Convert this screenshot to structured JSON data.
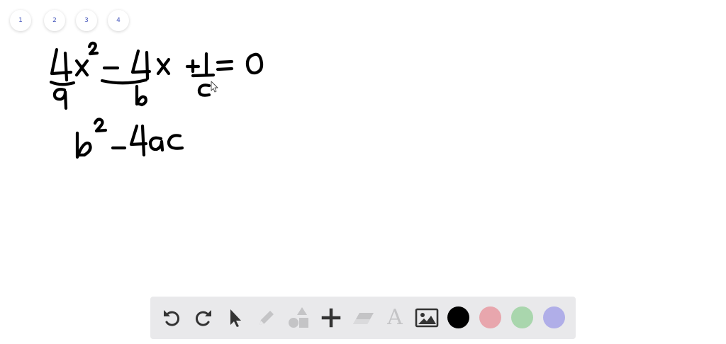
{
  "pages": {
    "tabs": [
      {
        "label": "1"
      },
      {
        "label": "2"
      },
      {
        "label": "3"
      },
      {
        "label": "4"
      }
    ]
  },
  "toolbar": {
    "tools": [
      {
        "name": "undo",
        "icon": "undo-icon",
        "enabled": true
      },
      {
        "name": "redo",
        "icon": "redo-icon",
        "enabled": true
      },
      {
        "name": "select",
        "icon": "cursor-arrow-icon",
        "enabled": true
      },
      {
        "name": "pen",
        "icon": "pencil-icon",
        "enabled": false
      },
      {
        "name": "shapes",
        "icon": "shapes-icon",
        "enabled": false
      },
      {
        "name": "add",
        "icon": "plus-icon",
        "enabled": true
      },
      {
        "name": "eraser",
        "icon": "eraser-icon",
        "enabled": false
      },
      {
        "name": "text",
        "icon": "text-icon",
        "label": "A",
        "enabled": false
      },
      {
        "name": "image",
        "icon": "image-icon",
        "enabled": true
      }
    ],
    "colors": [
      {
        "name": "black",
        "hex": "#000000"
      },
      {
        "name": "pink",
        "hex": "#e8a6ad"
      },
      {
        "name": "green",
        "hex": "#a9d6ad"
      },
      {
        "name": "purple",
        "hex": "#b0aee8"
      }
    ]
  },
  "theme": {
    "background": "#ffffff",
    "toolbar_bg": "#e9e9eb",
    "icon_active": "#333333",
    "icon_disabled": "#c4c4c6",
    "tab_text": "#4a5bbd"
  }
}
